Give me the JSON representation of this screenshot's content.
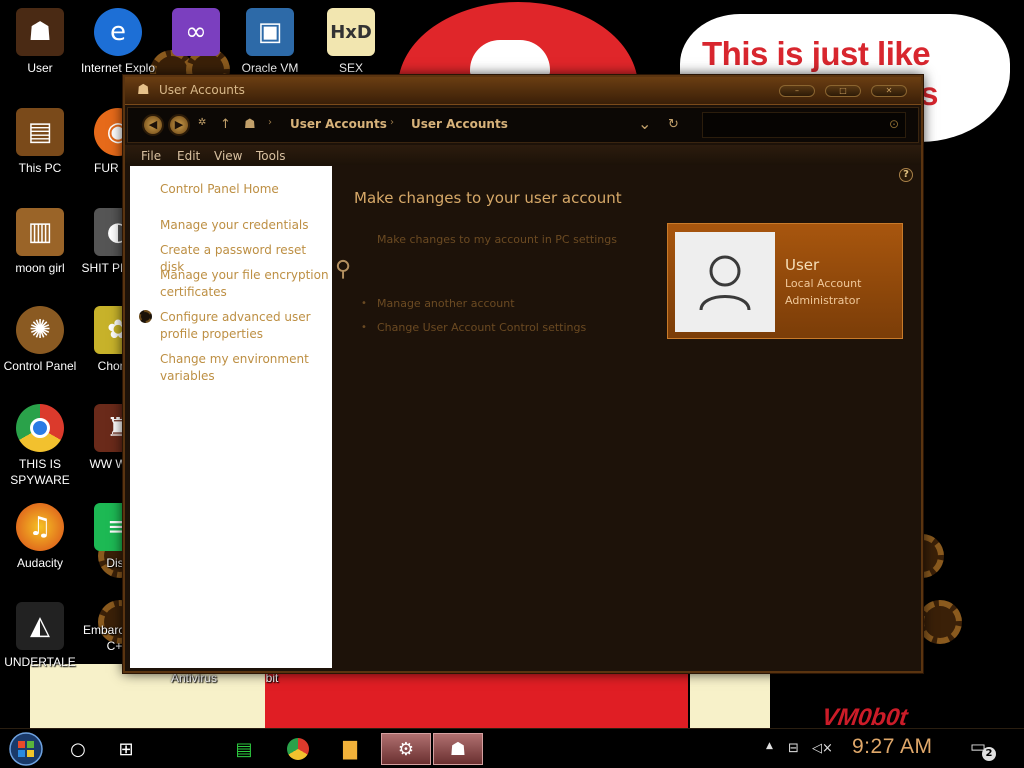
{
  "desktop": {
    "icons": [
      {
        "label": "User",
        "icon": "user-icon"
      },
      {
        "label": "Internet Explo",
        "icon": "edge-browser-icon"
      },
      {
        "label": "",
        "icon": "visual-studio-icon"
      },
      {
        "label": "Oracle VM",
        "icon": "virtualbox-icon"
      },
      {
        "label": "SEX",
        "icon": "hxd-editor-icon"
      },
      {
        "label": "This PC",
        "icon": "this-pc-icon"
      },
      {
        "label": "FUR UW",
        "icon": "firefox-icon"
      },
      {
        "label": "moon girl",
        "icon": "folder-icon"
      },
      {
        "label": "SHIT PHOTO",
        "icon": "gimp-icon"
      },
      {
        "label": "Control Panel",
        "icon": "control-panel-icon"
      },
      {
        "label": "Chomik",
        "icon": "chomik-icon"
      },
      {
        "label": "THIS IS SPYWARE",
        "icon": "chrome-icon"
      },
      {
        "label": "WW Wrest",
        "icon": "wrestling-icon"
      },
      {
        "label": "Audacity",
        "icon": "audacity-icon"
      },
      {
        "label": "Diss",
        "icon": "spotify-icon"
      },
      {
        "label": "UNDERTALE",
        "icon": "unity-icon"
      },
      {
        "label": "Embarc Dev-C++",
        "icon": "embarcadero-icon"
      },
      {
        "label": "Antivirus",
        "icon": "antivirus-icon"
      },
      {
        "label": "bit",
        "icon": "bit-icon"
      }
    ]
  },
  "wallpaper": {
    "bubble_text_line1": "This is just like",
    "bubble_text_line2": "'s",
    "stamp_text": "VM0b0t"
  },
  "window": {
    "title": "User Accounts",
    "controls": {
      "minimize": "–",
      "maximize": "□",
      "close": "✕"
    },
    "nav": {
      "back": "◀",
      "forward": "▶",
      "recent": "✲",
      "up": "↑",
      "breadcrumb": [
        "User Accounts",
        "User Accounts"
      ],
      "dropdown": "⌄",
      "refresh": "↻",
      "search_placeholder": ""
    },
    "menu": [
      "File",
      "Edit",
      "View",
      "Tools"
    ],
    "sidebar": {
      "home": "Control Panel Home",
      "links": [
        "Manage your credentials",
        "Create a password reset disk",
        "Manage your file encryption certificates",
        "Configure advanced user profile properties",
        "Change my environment variables"
      ]
    },
    "main": {
      "heading": "Make changes to your user account",
      "pc_settings_link": "Make changes to my account in PC settings",
      "tasks": [
        "Manage another account",
        "Change User Account Control settings"
      ],
      "user": {
        "name": "User",
        "type": "Local Account",
        "role": "Administrator"
      }
    }
  },
  "taskbar": {
    "clock": "9:27 AM",
    "notification_count": "2"
  },
  "colors": {
    "accent": "#d6a868",
    "window_bg": "#1d1209",
    "user_card": "#a8560e",
    "clock": "#e0a86a"
  }
}
